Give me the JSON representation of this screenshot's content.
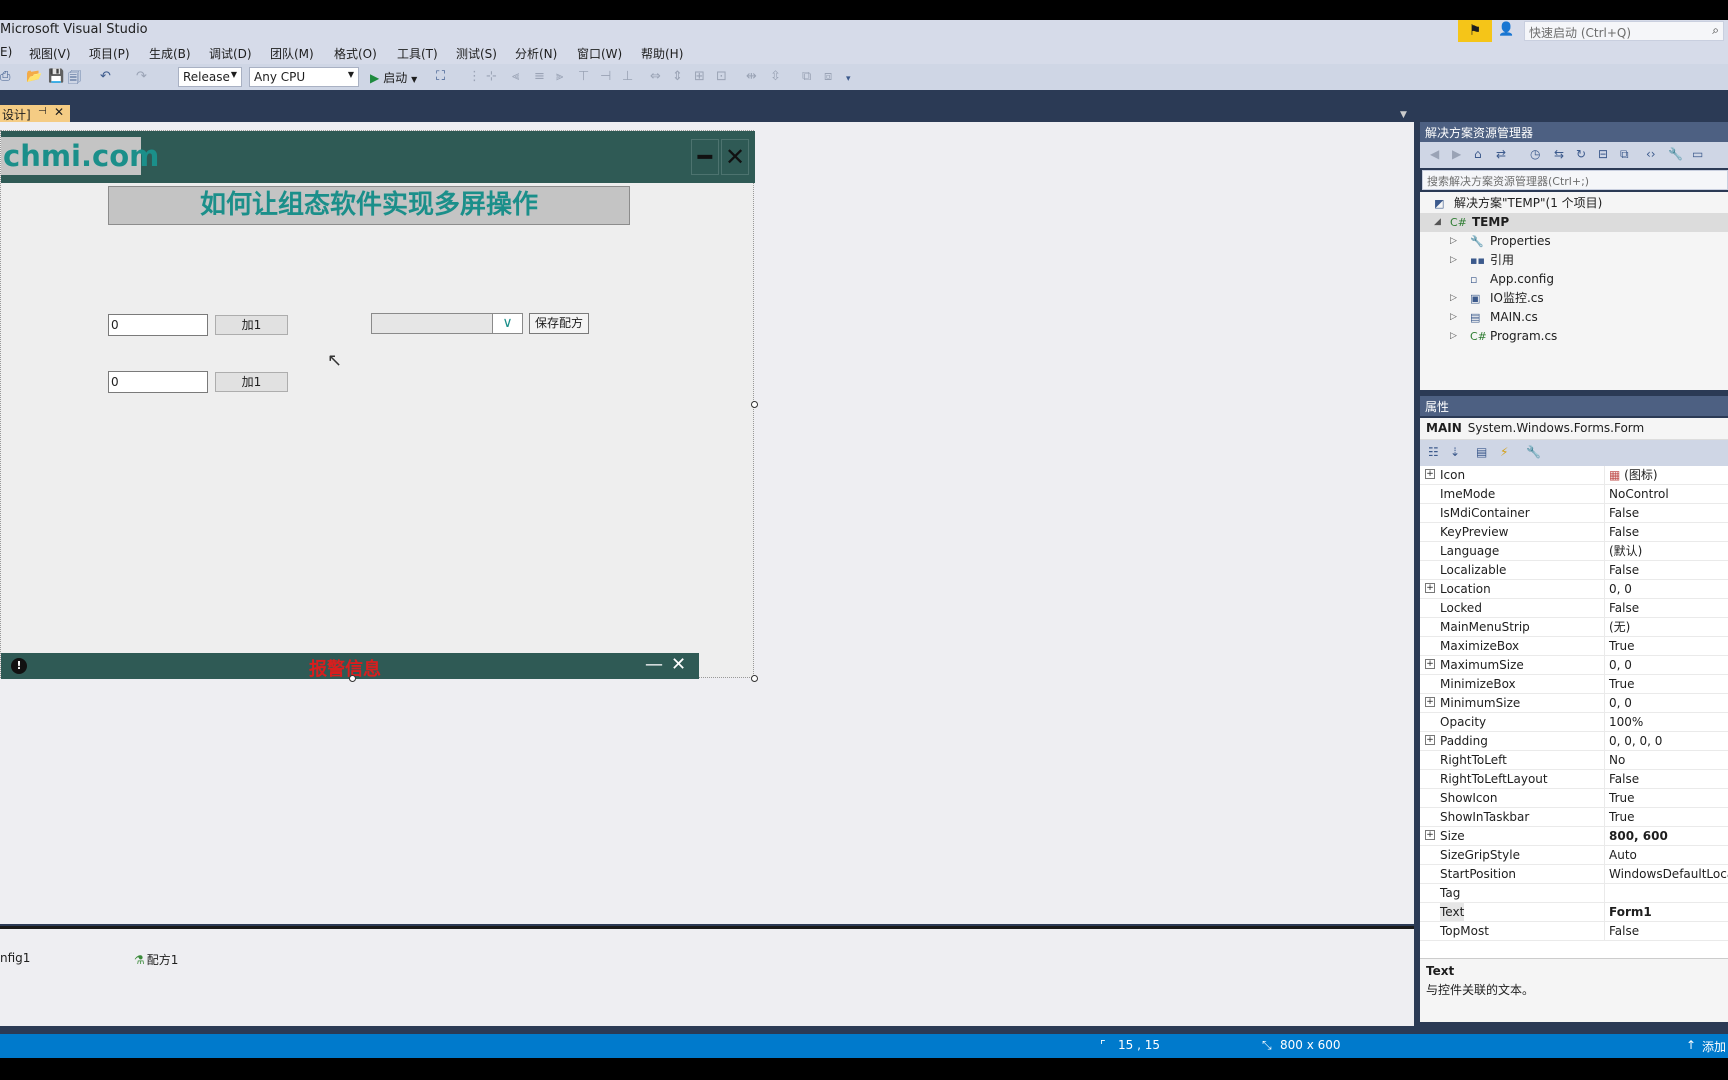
{
  "app": {
    "title": "Microsoft Visual Studio"
  },
  "quick_launch": {
    "placeholder": "快速启动 (Ctrl+Q)"
  },
  "menu": [
    "E)",
    "视图(V)",
    "项目(P)",
    "生成(B)",
    "调试(D)",
    "团队(M)",
    "格式(O)",
    "工具(T)",
    "测试(S)",
    "分析(N)",
    "窗口(W)",
    "帮助(H)"
  ],
  "toolbar": {
    "config": "Release",
    "platform": "Any CPU",
    "start_label": "启动"
  },
  "doc_tab": {
    "label": "设计]"
  },
  "form": {
    "brand": "chmi.com",
    "title": "如何让组态软件实现多屏操作",
    "textbox1": "0",
    "textbox2": "0",
    "add_btn1": "加1",
    "add_btn2": "加1",
    "dropdown_value": "",
    "save_btn": "保存配方",
    "alarm_label": "报警信息"
  },
  "tray": {
    "item1": "nfig1",
    "item2": "配方1"
  },
  "solution_explorer": {
    "title": "解决方案资源管理器",
    "search_placeholder": "搜索解决方案资源管理器(Ctrl+;)",
    "items": [
      {
        "label": "解决方案\"TEMP\"(1 个项目)",
        "icon": "solution-icon"
      },
      {
        "label": "TEMP",
        "icon": "csharp-project-icon"
      },
      {
        "label": "Properties",
        "icon": "wrench-icon"
      },
      {
        "label": "引用",
        "icon": "references-icon"
      },
      {
        "label": "App.config",
        "icon": "config-icon"
      },
      {
        "label": "IO监控.cs",
        "icon": "form-icon"
      },
      {
        "label": "MAIN.cs",
        "icon": "form-icon"
      },
      {
        "label": "Program.cs",
        "icon": "csharp-file-icon"
      }
    ]
  },
  "properties": {
    "title": "属性",
    "object_name": "MAIN",
    "object_type": "System.Windows.Forms.Form",
    "rows": [
      {
        "name": "Icon",
        "value": "(图标)",
        "expandable": true
      },
      {
        "name": "ImeMode",
        "value": "NoControl"
      },
      {
        "name": "IsMdiContainer",
        "value": "False"
      },
      {
        "name": "KeyPreview",
        "value": "False"
      },
      {
        "name": "Language",
        "value": "(默认)"
      },
      {
        "name": "Localizable",
        "value": "False"
      },
      {
        "name": "Location",
        "value": "0, 0",
        "expandable": true
      },
      {
        "name": "Locked",
        "value": "False"
      },
      {
        "name": "MainMenuStrip",
        "value": "(无)"
      },
      {
        "name": "MaximizeBox",
        "value": "True"
      },
      {
        "name": "MaximumSize",
        "value": "0, 0",
        "expandable": true
      },
      {
        "name": "MinimizeBox",
        "value": "True"
      },
      {
        "name": "MinimumSize",
        "value": "0, 0",
        "expandable": true
      },
      {
        "name": "Opacity",
        "value": "100%"
      },
      {
        "name": "Padding",
        "value": "0, 0, 0, 0",
        "expandable": true
      },
      {
        "name": "RightToLeft",
        "value": "No"
      },
      {
        "name": "RightToLeftLayout",
        "value": "False"
      },
      {
        "name": "ShowIcon",
        "value": "True"
      },
      {
        "name": "ShowInTaskbar",
        "value": "True"
      },
      {
        "name": "Size",
        "value": "800, 600",
        "expandable": true,
        "bold": true
      },
      {
        "name": "SizeGripStyle",
        "value": "Auto"
      },
      {
        "name": "StartPosition",
        "value": "WindowsDefaultLocation"
      },
      {
        "name": "Tag",
        "value": ""
      },
      {
        "name": "Text",
        "value": "Form1",
        "bold": true,
        "highlight": true
      },
      {
        "name": "TopMost",
        "value": "False"
      }
    ],
    "desc_title": "Text",
    "desc_text": "与控件关联的文本。"
  },
  "status": {
    "position": "15 , 15",
    "size": "800 x 600",
    "add": "添加"
  },
  "colors": {
    "accent": "#007acc",
    "form_header": "#2f5a55",
    "brand_text": "#1b8f8a",
    "alarm_text": "#d91e1e"
  }
}
